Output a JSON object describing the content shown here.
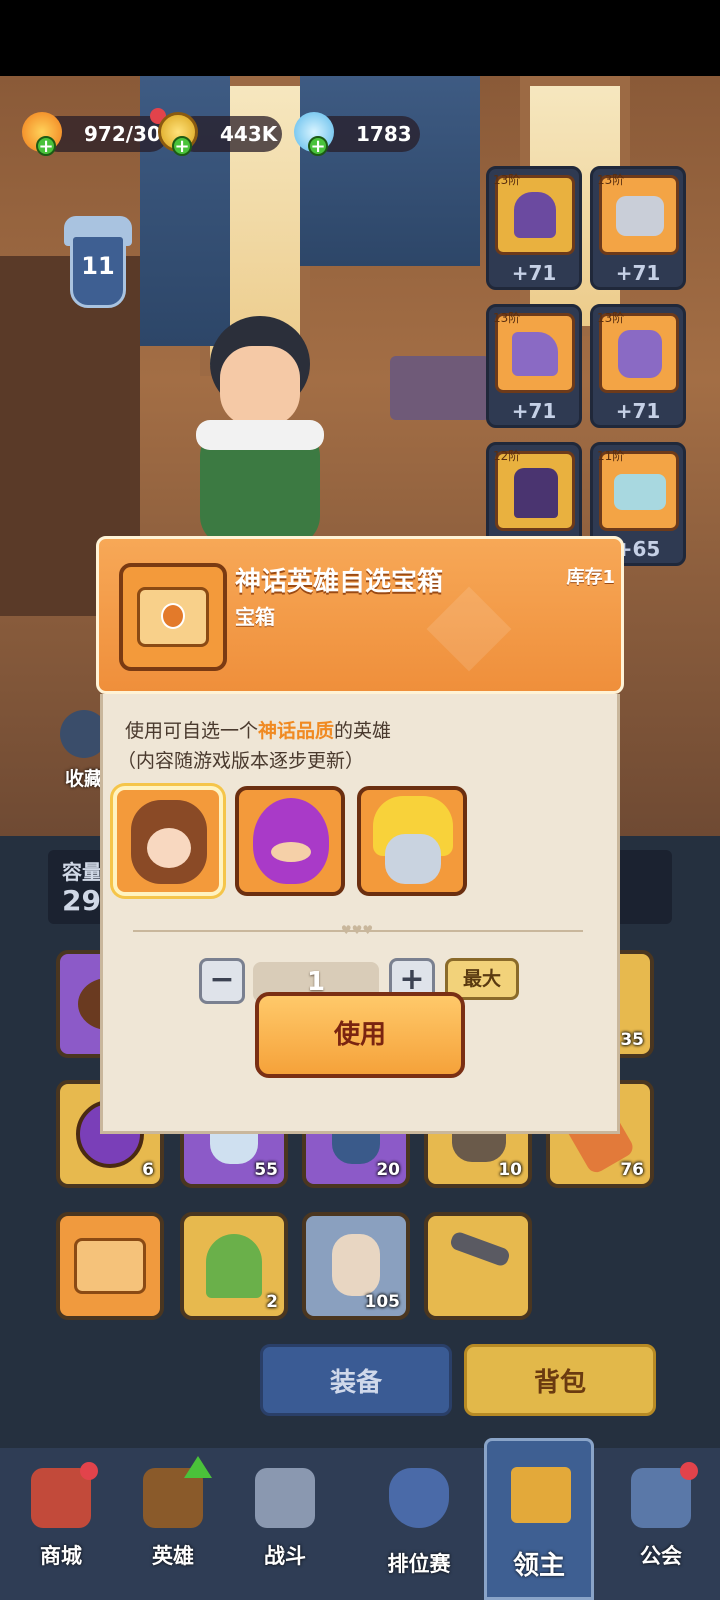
{
  "resources": {
    "stamina": "972/30",
    "gold": "443K",
    "gems": "1783"
  },
  "level": "11",
  "equipment": [
    {
      "tier": "13阶",
      "bonus": "+71",
      "icon": "helmet-icon"
    },
    {
      "tier": "13阶",
      "bonus": "+71",
      "icon": "armor-icon"
    },
    {
      "tier": "13阶",
      "bonus": "+71",
      "icon": "boots-icon"
    },
    {
      "tier": "13阶",
      "bonus": "+71",
      "icon": "gauntlet-icon"
    },
    {
      "tier": "12阶",
      "bonus": "",
      "icon": "cape-icon"
    },
    {
      "tier": "11阶",
      "bonus": "+65",
      "icon": "belt-icon"
    }
  ],
  "side_label": "收藏",
  "capacity": {
    "label": "容量",
    "value": "29"
  },
  "items_row1": [
    {
      "count": "",
      "color": "purple"
    },
    {
      "count": "35",
      "color": "gold"
    }
  ],
  "items_row2": [
    {
      "count": "6",
      "color": "gold"
    },
    {
      "count": "55",
      "color": "purple"
    },
    {
      "count": "20",
      "color": "purple"
    },
    {
      "count": "10",
      "color": "gold"
    },
    {
      "count": "76",
      "color": "gold"
    }
  ],
  "items_row3": [
    {
      "count": "",
      "color": "orange"
    },
    {
      "count": "2",
      "color": "gold"
    },
    {
      "count": "105",
      "color": "grey"
    },
    {
      "count": "",
      "color": "gold"
    }
  ],
  "tabs": {
    "equip": "装备",
    "bag": "背包"
  },
  "nav": [
    {
      "label": "商城",
      "icon": "shop-icon"
    },
    {
      "label": "英雄",
      "icon": "hero-card-icon"
    },
    {
      "label": "战斗",
      "icon": "crossed-swords-icon"
    },
    {
      "label": "排位赛",
      "icon": "ranking-shield-icon"
    },
    {
      "label": "领主",
      "icon": "crown-banner-icon"
    },
    {
      "label": "公会",
      "icon": "guild-castle-icon"
    }
  ],
  "modal": {
    "title": "神话英雄自选宝箱",
    "type": "宝箱",
    "stock": "库存1",
    "desc_prefix": "使用可自选一个",
    "desc_highlight": "神话品质",
    "desc_suffix": "的英雄",
    "desc_note": "（内容随游戏版本逐步更新）",
    "quantity": "1",
    "max_label": "最大",
    "use_label": "使用",
    "minus": "−",
    "plus": "+"
  },
  "colors": {
    "highlight": "#f08a22",
    "modal_header": "#f39b45",
    "panel_bg": "#25303f",
    "nav_bg": "#2f3d55"
  }
}
